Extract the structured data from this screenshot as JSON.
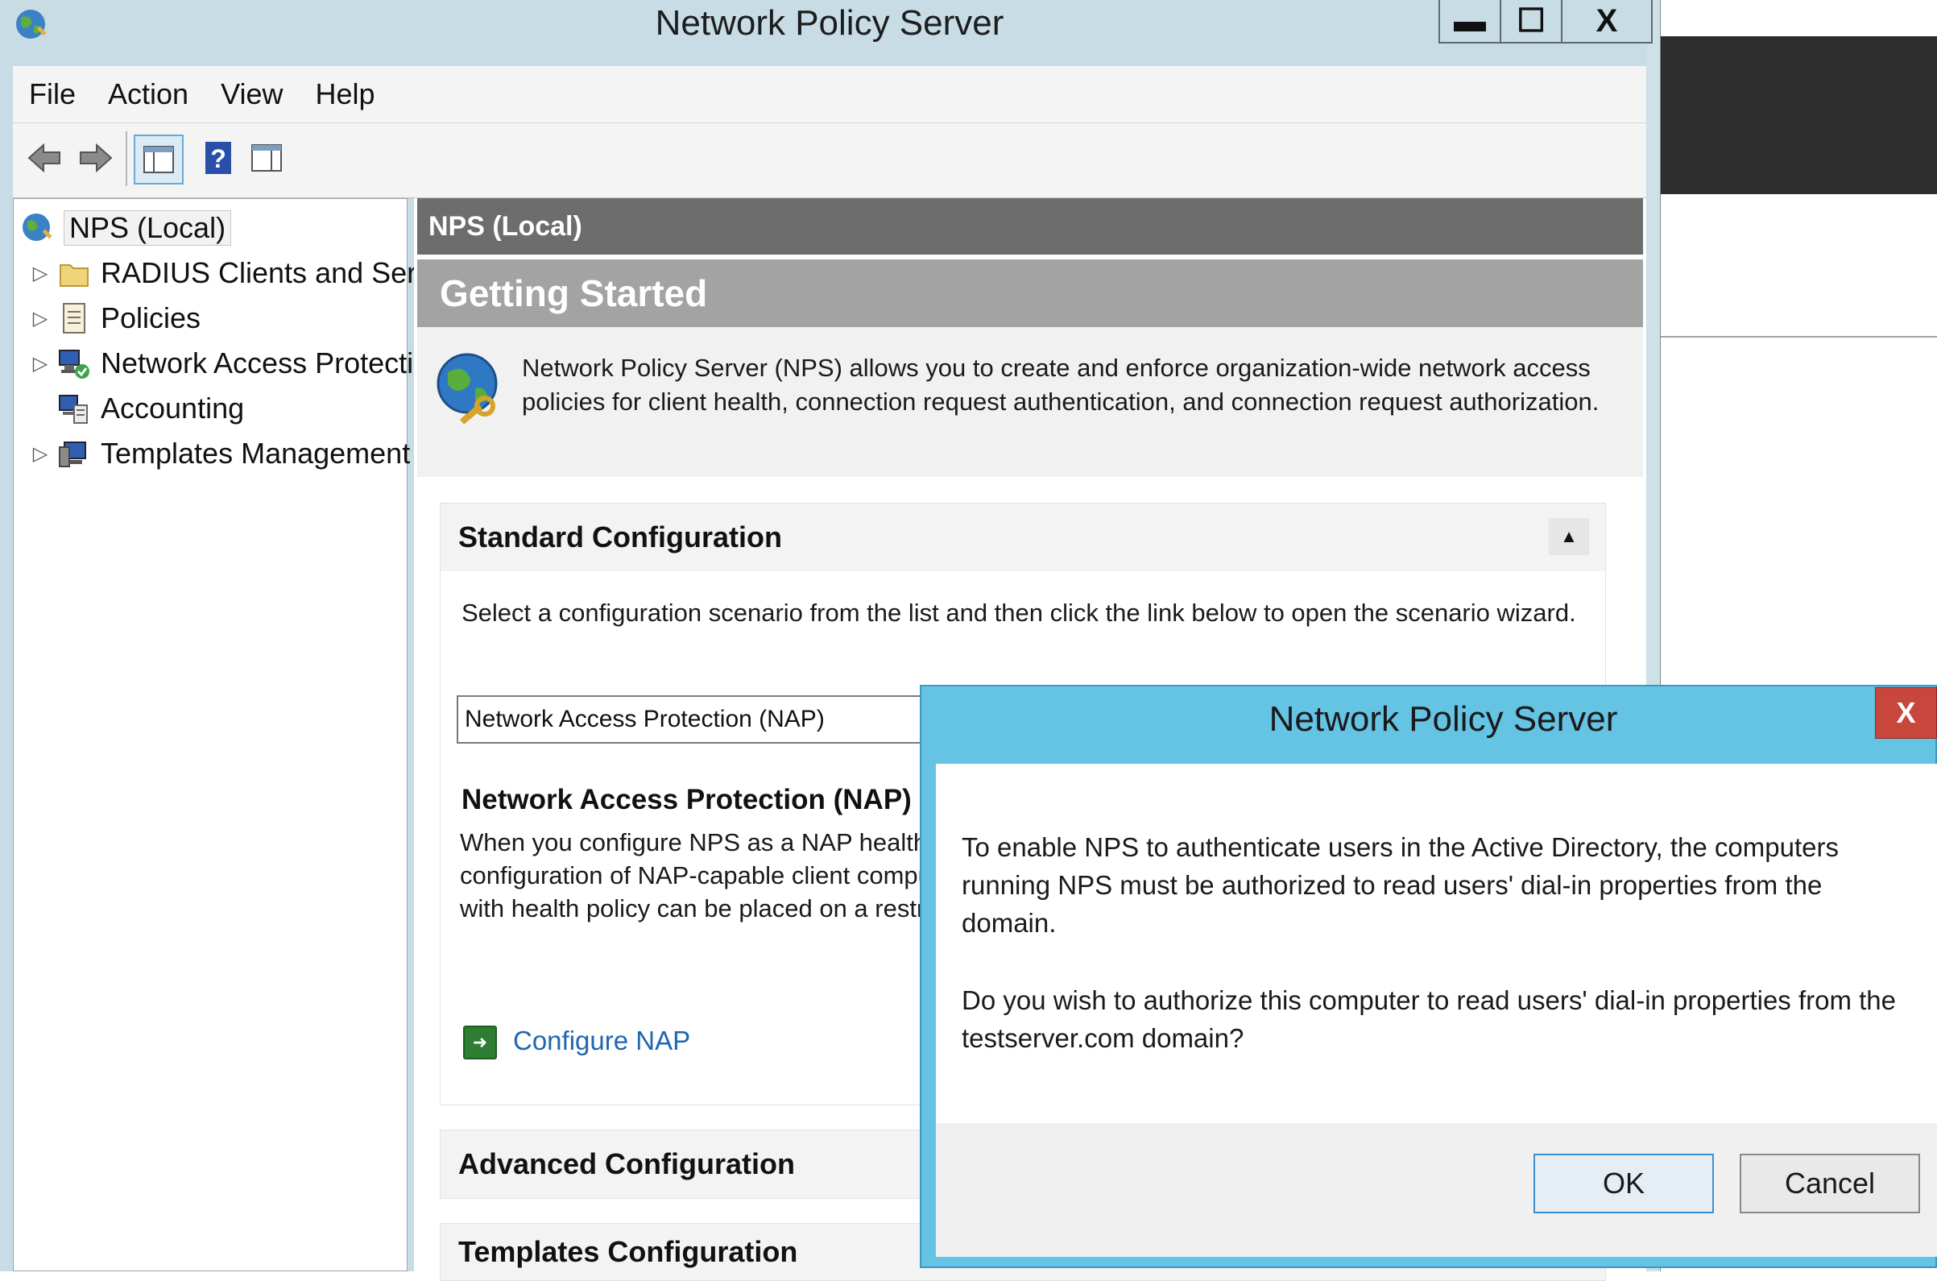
{
  "window": {
    "title": "Network Policy Server",
    "controls": {
      "minimize": "▬",
      "maximize": "☐",
      "close": "X"
    }
  },
  "menu": [
    "File",
    "Action",
    "View",
    "Help"
  ],
  "tree": {
    "root": "NPS (Local)",
    "items": [
      {
        "label": "RADIUS Clients and Servers",
        "expandable": true,
        "icon": "folder-icon"
      },
      {
        "label": "Policies",
        "expandable": true,
        "icon": "document-icon"
      },
      {
        "label": "Network Access Protection",
        "expandable": true,
        "icon": "nap-icon"
      },
      {
        "label": "Accounting",
        "expandable": false,
        "icon": "accounting-icon"
      },
      {
        "label": "Templates Management",
        "expandable": true,
        "icon": "templates-icon"
      }
    ]
  },
  "content": {
    "header": "NPS (Local)",
    "getting_started": "Getting Started",
    "intro": "Network Policy Server (NPS) allows you to create and enforce organization-wide network access policies for client health, connection request authentication, and connection request authorization.",
    "standard": {
      "title": "Standard Configuration",
      "description": "Select a configuration scenario from the list and then click the link below to open the scenario wizard.",
      "selected_scenario": "Network Access Protection (NAP)",
      "scenario_heading": "Network Access Protection (NAP)",
      "scenario_desc_lines": [
        "When you configure NPS as a NAP health poli",
        "configuration of NAP-capable client computers",
        "with health policy can be placed on a restricted"
      ],
      "link": "Configure NAP"
    },
    "advanced": {
      "title": "Advanced Configuration"
    },
    "templates": {
      "title": "Templates Configuration"
    }
  },
  "dialog": {
    "title": "Network Policy Server",
    "close": "X",
    "message_1_lines": [
      "To enable NPS to authenticate users in the Active Directory, the computers",
      "running NPS must be authorized to read users' dial-in properties from the",
      "domain."
    ],
    "message_2_lines": [
      "Do you wish to authorize this computer to read users' dial-in  properties from the",
      "testserver.com domain?"
    ],
    "ok": "OK",
    "cancel": "Cancel"
  },
  "colors": {
    "window_frame": "#c7dce4",
    "dialog_frame": "#65c3e4",
    "header_bar": "#6d6d6d",
    "getting_started_bar": "#a3a3a3",
    "close_button": "#c8473c",
    "link": "#1f66b3"
  }
}
